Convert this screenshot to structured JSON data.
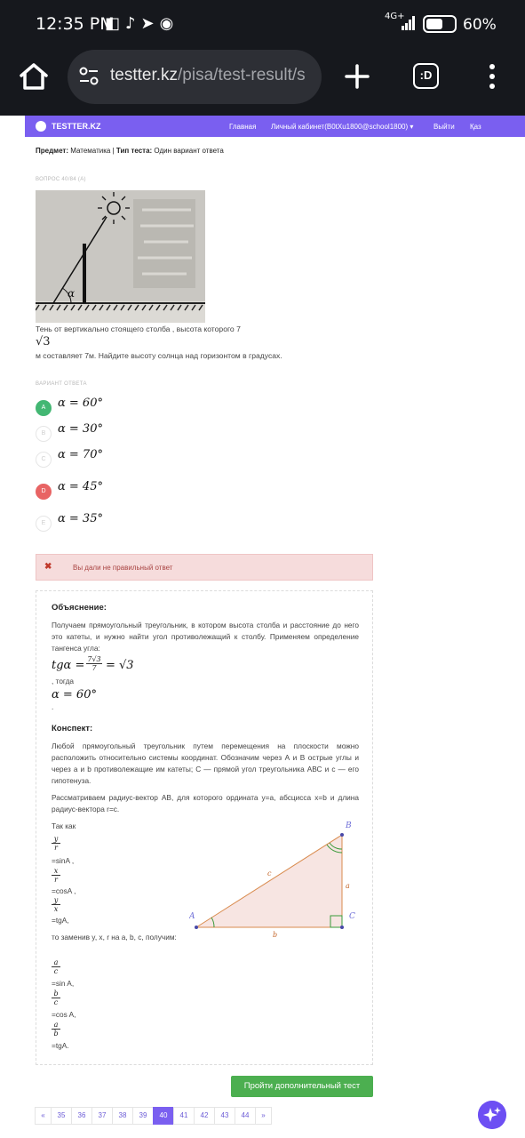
{
  "status_bar": {
    "time": "12:35 PM",
    "network": "4G+",
    "battery": "60%"
  },
  "browser": {
    "url_main": "testter.kz",
    "url_rest": "/pisa/test-result/s",
    "tabs_label": ":D"
  },
  "site_nav": {
    "brand": "TESTTER.KZ",
    "items": [
      "Главная",
      "Личный кабинет(B0tXu1800@school1800) ▾",
      "Выйти",
      "Қаз"
    ]
  },
  "meta": {
    "subject_label": "Предмет:",
    "subject": "Математика",
    "sep": "|",
    "type_label": "Тип теста:",
    "type": "Один вариант ответа"
  },
  "question": {
    "label": "ВОПРОС 40/84 (А)",
    "image_alpha": "α",
    "text_1": "Тень  от вертикально стоящего столба , высота которого 7",
    "sqrt": "√3",
    "text_2": "м составляет 7м. Найдите высоту солнца над горизонтом в градусах."
  },
  "answers": {
    "label": "ВАРИАНТ ОТВЕТА",
    "options": [
      {
        "letter": "A",
        "formula": "α = 60°",
        "state": "correct"
      },
      {
        "letter": "B",
        "formula": "α = 30°",
        "state": "none"
      },
      {
        "letter": "C",
        "formula": "α = 70°",
        "state": "none"
      },
      {
        "letter": "D",
        "formula": "α = 45°",
        "state": "wrong"
      },
      {
        "letter": "E",
        "formula": "α = 35°",
        "state": "none"
      }
    ]
  },
  "alert": {
    "icon": "✖",
    "message": "Вы дали не правильный ответ"
  },
  "explanation": {
    "title": "Объяснение:",
    "text": "Получаем прямоугольный треугольник, в котором высота столба и расстояние до него это катеты, и нужно найти угол противолежащий к столбу. Применяем определение тангенса угла:",
    "formula_lhs": "tgα =",
    "frac_num": "7√3",
    "frac_den": "7",
    "formula_rhs": "= √3",
    "then": ", тогда",
    "result": "α = 60°",
    "dot": "."
  },
  "konspekt": {
    "title": "Конспект:",
    "p1": "Любой прямоугольный треугольник путем перемещения на плоскости можно расположить относительно системы координат. Обозначим через А и В острые углы и через a и b противолежащие им катеты; С — прямой угол треугольника АВС и с — его гипотенуза.",
    "p2": "Рассматриваем радиус-вектор АВ, для которого ордината y=a, абсцисса x=b и длина радиус-вектора r=c.",
    "tak_kak": "Так как",
    "f1": {
      "num": "y",
      "den": "r",
      "text": "=sinA ,"
    },
    "f2": {
      "num": "x",
      "den": "r",
      "text": "=cosA ,"
    },
    "f3": {
      "num": "y",
      "den": "x",
      "text": "=tgA,"
    },
    "replace": "то  заменив  y,  x,  r  на  a,  b,  c, получим:",
    "g1": {
      "num": "a",
      "den": "c",
      "text": "=sin A,"
    },
    "g2": {
      "num": "b",
      "den": "c",
      "text": "=cos A,"
    },
    "g3": {
      "num": "a",
      "den": "b",
      "text": "=tgA."
    },
    "triangle": {
      "A": "A",
      "B": "B",
      "C": "C",
      "a": "a",
      "b": "b",
      "c": "c"
    }
  },
  "more_button": "Пройти дополнительный тест",
  "pagination": {
    "prev": "«",
    "pages": [
      "35",
      "36",
      "37",
      "38",
      "39",
      "40",
      "41",
      "42",
      "43",
      "44"
    ],
    "active": "40",
    "next": "»"
  }
}
